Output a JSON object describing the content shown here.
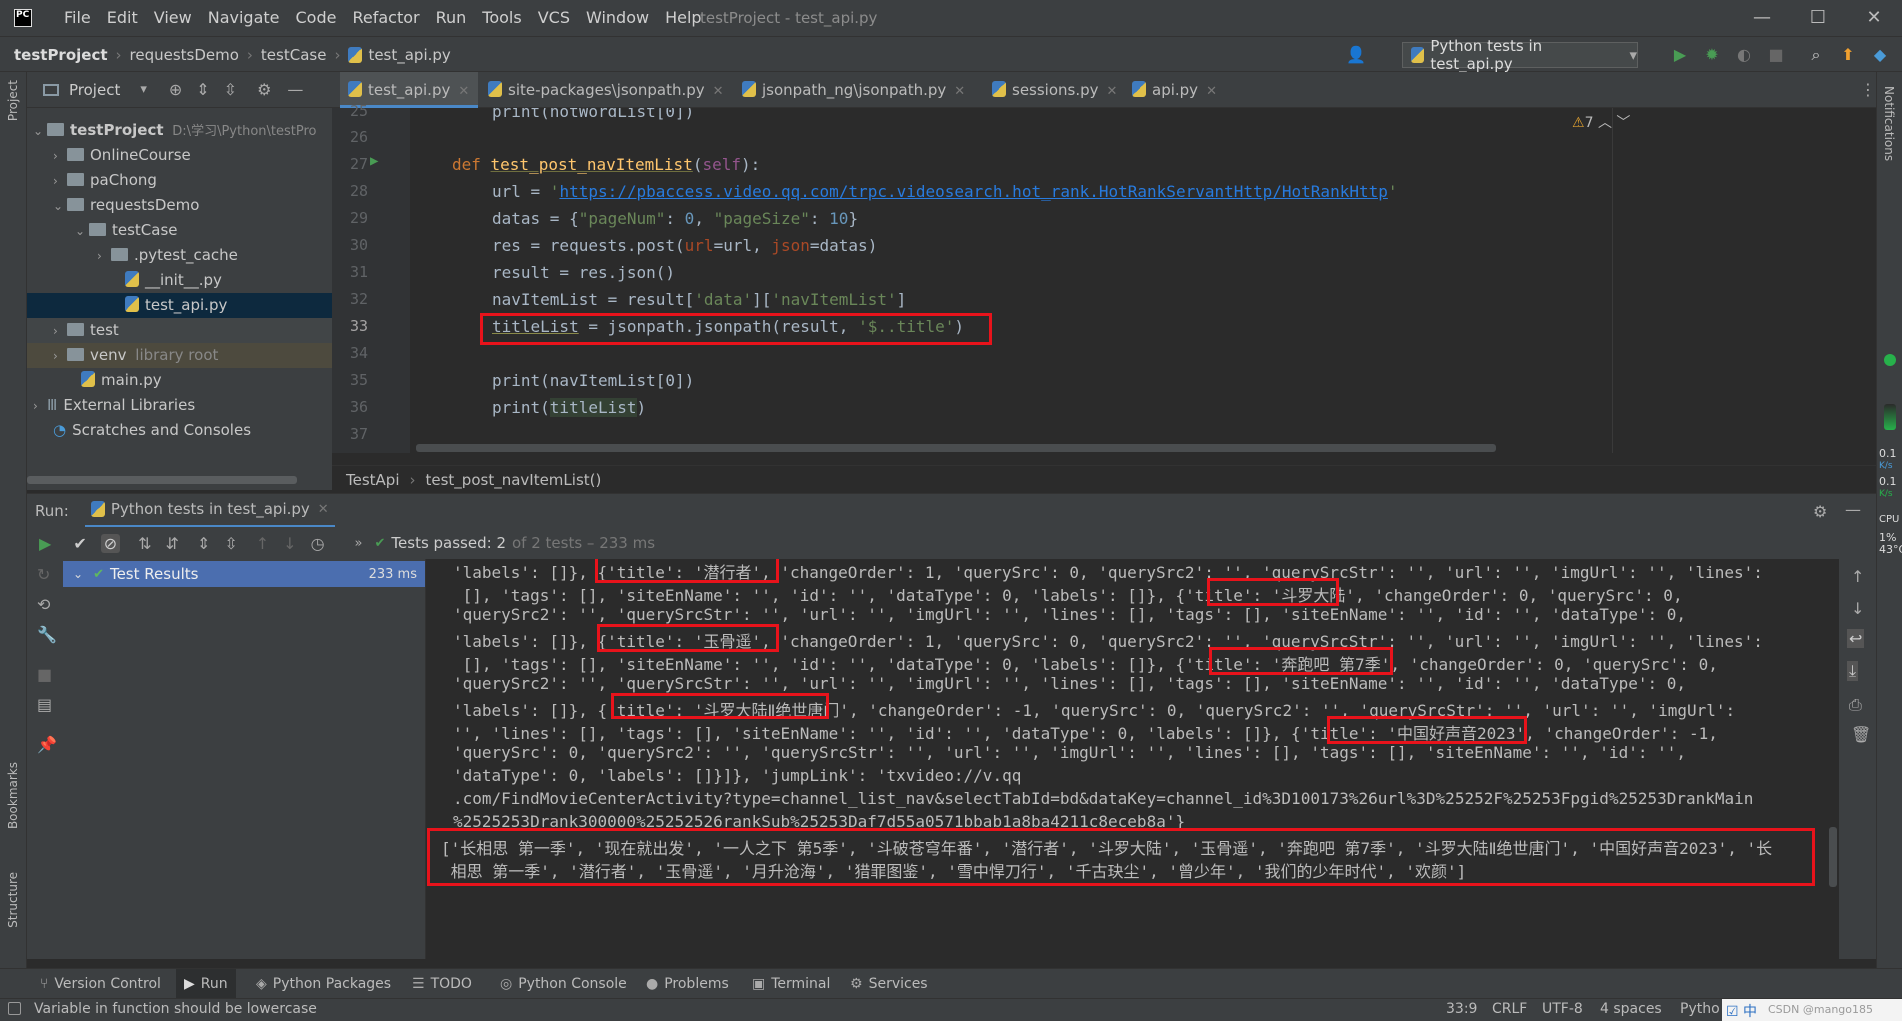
{
  "window": {
    "title": "testProject - test_api.py",
    "menu": [
      "File",
      "Edit",
      "View",
      "Navigate",
      "Code",
      "Refactor",
      "Run",
      "Tools",
      "VCS",
      "Window",
      "Help"
    ]
  },
  "breadcrumb": [
    "testProject",
    "requestsDemo",
    "testCase",
    "test_api.py"
  ],
  "run_config": "Python tests in test_api.py",
  "left_strip": [
    "Project",
    "Bookmarks",
    "Structure"
  ],
  "right_strip": [
    "Notifications"
  ],
  "project_panel": {
    "title": "Project",
    "tree": [
      {
        "label": "testProject",
        "extra": "D:\\学习\\Python\\testPro"
      },
      {
        "label": "OnlineCourse"
      },
      {
        "label": "paChong"
      },
      {
        "label": "requestsDemo"
      },
      {
        "label": "testCase"
      },
      {
        "label": ".pytest_cache"
      },
      {
        "label": "__init__.py"
      },
      {
        "label": "test_api.py"
      },
      {
        "label": "test"
      },
      {
        "label": "venv",
        "extra": "library root"
      },
      {
        "label": "main.py"
      },
      {
        "label": "External Libraries"
      },
      {
        "label": "Scratches and Consoles"
      }
    ]
  },
  "editor": {
    "tabs": [
      "test_api.py",
      "site-packages\\jsonpath.py",
      "jsonpath_ng\\jsonpath.py",
      "sessions.py",
      "api.py"
    ],
    "line_numbers": [
      "25",
      "26",
      "27",
      "28",
      "29",
      "30",
      "31",
      "32",
      "33",
      "34",
      "35",
      "36",
      "37"
    ],
    "warnings": "7",
    "code": {
      "l25": "print(notWordList[0])",
      "l27_kw": "def ",
      "l27_fn": "test_post_navItemList",
      "l27_self": "self",
      "l28_a": "url = ",
      "l28_url": "https://pbaccess.video.qq.com/trpc.videosearch.hot_rank.HotRankServantHttp/HotRankHttp",
      "l29_a": "datas = {",
      "l29_k1": "\"pageNum\"",
      "l29_v1": "0",
      "l29_k2": "\"pageSize\"",
      "l29_v2": "10",
      "l30_a": "res = requests.post(",
      "l30_p1": "url",
      "l30_b": "=url, ",
      "l30_p2": "json",
      "l30_c": "=datas)",
      "l31": "result = res.json()",
      "l32_a": "navItemList = result[",
      "l32_s1": "'data'",
      "l32_s2": "'navItemList'",
      "l33_a": "titleList",
      "l33_b": " = jsonpath.jsonpath(result, ",
      "l33_s": "'$..title'",
      "l35": "print(navItemList[0])",
      "l36_a": "print(",
      "l36_b": "titleList",
      "l36_c": ")"
    },
    "breadcrumb": [
      "TestApi",
      "test_post_navItemList()"
    ]
  },
  "run_panel": {
    "label": "Run:",
    "tab": "Python tests in test_api.py",
    "status_strong": "Tests passed: 2",
    "status_dim": "of 2 tests – 233 ms",
    "tree_item": "Test Results",
    "tree_time": "233 ms",
    "console_lines": [
      "'labels': []}, {'title': '潜行者', 'changeOrder': 1, 'querySrc': 0, 'querySrc2': '', 'querySrcStr': '', 'url': '', 'imgUrl': '', 'lines':",
      " [], 'tags': [], 'siteEnName': '', 'id': '', 'dataType': 0, 'labels': []}, {'title': '斗罗大陆', 'changeOrder': 0, 'querySrc': 0,",
      "'querySrc2': '', 'querySrcStr': '', 'url': '', 'imgUrl': '', 'lines': [], 'tags': [], 'siteEnName': '', 'id': '', 'dataType': 0,",
      "'labels': []}, {'title': '玉骨遥', 'changeOrder': 1, 'querySrc': 0, 'querySrc2': '', 'querySrcStr': '', 'url': '', 'imgUrl': '', 'lines':",
      " [], 'tags': [], 'siteEnName': '', 'id': '', 'dataType': 0, 'labels': []}, {'title': '奔跑吧 第7季', 'changeOrder': 0, 'querySrc': 0,",
      "'querySrc2': '', 'querySrcStr': '', 'url': '', 'imgUrl': '', 'lines': [], 'tags': [], 'siteEnName': '', 'id': '', 'dataType': 0,",
      "'labels': []}, {'title': '斗罗大陆Ⅱ绝世唐门', 'changeOrder': -1, 'querySrc': 0, 'querySrc2': '', 'querySrcStr': '', 'url': '', 'imgUrl':",
      "'', 'lines': [], 'tags': [], 'siteEnName': '', 'id': '', 'dataType': 0, 'labels': []}, {'title': '中国好声音2023', 'changeOrder': -1,",
      "'querySrc': 0, 'querySrc2': '', 'querySrcStr': '', 'url': '', 'imgUrl': '', 'lines': [], 'tags': [], 'siteEnName': '', 'id': '',",
      "'dataType': 0, 'labels': []}]}, 'jumpLink': 'txvideo://v.qq",
      ".com/FindMovieCenterActivity?type=channel_list_nav&selectTabId=bd&dataKey=channel_id%3D100173%26url%3D%25252F%25253Fpgid%25253DrankMain",
      "%2525253Drank300000%25252526rankSub%25253Daf7d55a0571bbab1a8ba4211c8eceb8a'}",
      "['长相思 第一季', '现在就出发', '一人之下 第5季', '斗破苍穹年番', '潜行者', '斗罗大陆', '玉骨遥', '奔跑吧 第7季', '斗罗大陆Ⅱ绝世唐门', '中国好声音2023', '长",
      " 相思 第一季', '潜行者', '玉骨遥', '月升沧海', '猎罪图鉴', '雪中悍刀行', '千古玦尘', '曾少年', '我们的少年时代', '欢颜']"
    ]
  },
  "bottom_tools": [
    "Version Control",
    "Run",
    "Python Packages",
    "TODO",
    "Python Console",
    "Problems",
    "Terminal",
    "Services"
  ],
  "status": {
    "message": "Variable in function should be lowercase",
    "position": "33:9",
    "line_sep": "CRLF",
    "encoding": "UTF-8",
    "indent": "4 spaces",
    "interpreter": "Pytho",
    "watermark": "CSDN @mango185"
  },
  "monitor": {
    "v1": "0.1",
    "u1": "K/s",
    "v2": "0.1",
    "u2": "K/s",
    "cpu": "CPU",
    "cpu_val": "1%",
    "temp": "43°C"
  },
  "colors": {
    "accent": "#4a88c7",
    "highlight_box": "#e8131b",
    "run_green": "#499c54"
  }
}
